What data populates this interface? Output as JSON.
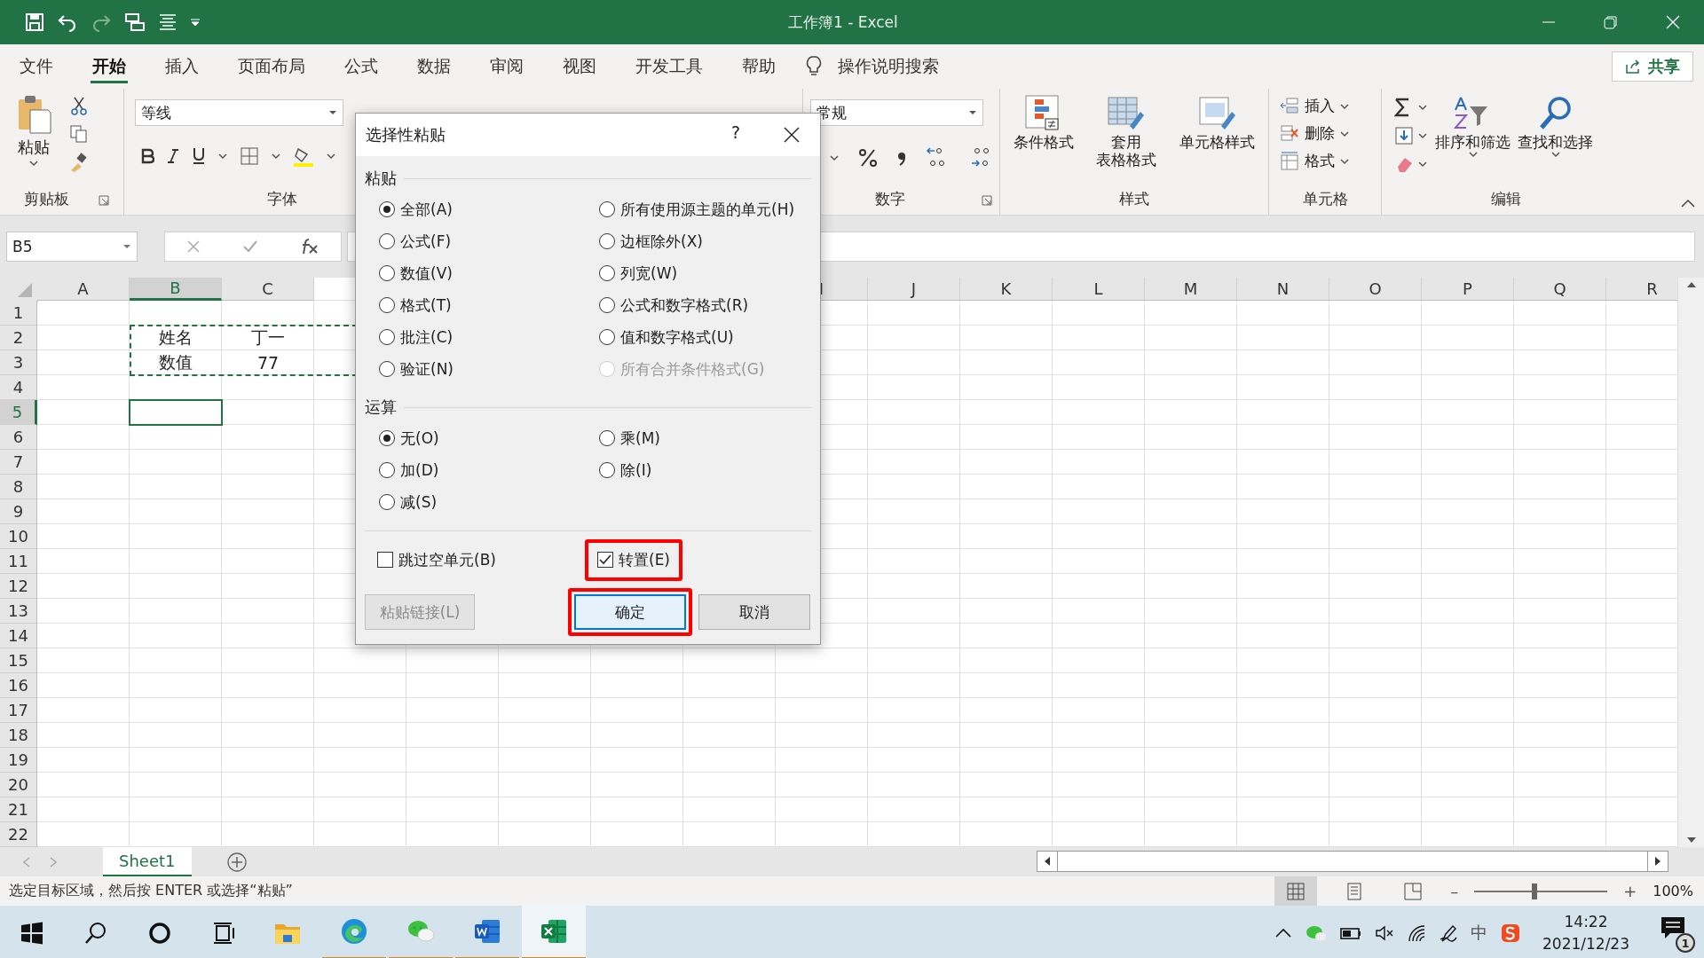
{
  "title_bar": {
    "title": "工作簿1  -  Excel"
  },
  "ribbon_tabs": [
    {
      "label": "文件",
      "selected": false
    },
    {
      "label": "开始",
      "selected": true
    },
    {
      "label": "插入",
      "selected": false
    },
    {
      "label": "页面布局",
      "selected": false
    },
    {
      "label": "公式",
      "selected": false
    },
    {
      "label": "数据",
      "selected": false
    },
    {
      "label": "审阅",
      "selected": false
    },
    {
      "label": "视图",
      "selected": false
    },
    {
      "label": "开发工具",
      "selected": false
    },
    {
      "label": "帮助",
      "selected": false
    }
  ],
  "tell_me": {
    "placeholder": "操作说明搜索"
  },
  "share_button": {
    "label": "共享"
  },
  "ribbon": {
    "clipboard": {
      "label": "剪贴板",
      "paste": "粘贴"
    },
    "font": {
      "label": "字体",
      "font_name": "等线"
    },
    "number": {
      "label": "数字",
      "format": "常规"
    },
    "styles": {
      "label": "样式",
      "buttons": [
        {
          "lines": [
            "条件格式"
          ]
        },
        {
          "lines": [
            "套用",
            "表格格式"
          ]
        },
        {
          "lines": [
            "单元格样式"
          ]
        }
      ]
    },
    "cells": {
      "label": "单元格",
      "buttons": [
        "插入",
        "删除",
        "格式"
      ]
    },
    "editing": {
      "label": "编辑",
      "buttons": [
        "排序和筛选",
        "查找和选择"
      ]
    }
  },
  "formula_bar": {
    "name_box": "B5"
  },
  "sheet": {
    "columns": [
      {
        "label": "A",
        "selected": false
      },
      {
        "label": "B",
        "selected": true
      },
      {
        "label": "C",
        "selected": false
      },
      {
        "label": "I",
        "selected": false
      },
      {
        "label": "J",
        "selected": false
      },
      {
        "label": "K",
        "selected": false
      },
      {
        "label": "L",
        "selected": false
      },
      {
        "label": "M",
        "selected": false
      },
      {
        "label": "N",
        "selected": false
      },
      {
        "label": "O",
        "selected": false
      },
      {
        "label": "P",
        "selected": false
      },
      {
        "label": "Q",
        "selected": false
      },
      {
        "label": "R",
        "selected": false
      }
    ],
    "rows": [
      {
        "header": "1",
        "selected": false
      },
      {
        "header": "2",
        "selected": false,
        "copied": true,
        "cells": {
          "B": "姓名",
          "C": "丁一"
        }
      },
      {
        "header": "3",
        "selected": false,
        "copied": true,
        "cells": {
          "B": "数值",
          "C": "77"
        }
      },
      {
        "header": "4",
        "selected": false
      },
      {
        "header": "5",
        "selected": true
      },
      {
        "header": "6",
        "selected": false
      },
      {
        "header": "7",
        "selected": false
      },
      {
        "header": "8",
        "selected": false
      },
      {
        "header": "9",
        "selected": false
      },
      {
        "header": "10",
        "selected": false
      },
      {
        "header": "11",
        "selected": false
      },
      {
        "header": "12",
        "selected": false
      },
      {
        "header": "13",
        "selected": false
      },
      {
        "header": "14",
        "selected": false
      },
      {
        "header": "15",
        "selected": false
      },
      {
        "header": "16",
        "selected": false
      },
      {
        "header": "17",
        "selected": false
      },
      {
        "header": "18",
        "selected": false
      },
      {
        "header": "19",
        "selected": false
      },
      {
        "header": "20",
        "selected": false
      },
      {
        "header": "21",
        "selected": false
      },
      {
        "header": "22",
        "selected": false
      }
    ]
  },
  "sheet_tabs": [
    {
      "label": "Sheet1",
      "selected": true
    }
  ],
  "status_bar": {
    "message": "选定目标区域，然后按 ENTER 或选择“粘贴”",
    "zoom_minus": "–",
    "zoom_plus": "+",
    "zoom": {
      "level": 0.45
    },
    "zoom_text": "100%"
  },
  "dialog": {
    "title": "选择性粘贴",
    "help": "?",
    "sections": [
      {
        "label": "粘贴",
        "options": [
          {
            "label": "全部(A)",
            "selected": true,
            "disabled": false
          },
          {
            "label": "所有使用源主题的单元(H)",
            "selected": false,
            "disabled": false
          },
          {
            "label": "公式(F)",
            "selected": false,
            "disabled": false
          },
          {
            "label": "边框除外(X)",
            "selected": false,
            "disabled": false
          },
          {
            "label": "数值(V)",
            "selected": false,
            "disabled": false
          },
          {
            "label": "列宽(W)",
            "selected": false,
            "disabled": false
          },
          {
            "label": "格式(T)",
            "selected": false,
            "disabled": false
          },
          {
            "label": "公式和数字格式(R)",
            "selected": false,
            "disabled": false
          },
          {
            "label": "批注(C)",
            "selected": false,
            "disabled": false
          },
          {
            "label": "值和数字格式(U)",
            "selected": false,
            "disabled": false
          },
          {
            "label": "验证(N)",
            "selected": false,
            "disabled": false
          },
          {
            "label": "所有合并条件格式(G)",
            "selected": false,
            "disabled": true
          }
        ]
      },
      {
        "label": "运算",
        "options": [
          {
            "label": "无(O)",
            "selected": true,
            "disabled": false
          },
          {
            "label": "乘(M)",
            "selected": false,
            "disabled": false
          },
          {
            "label": "加(D)",
            "selected": false,
            "disabled": false
          },
          {
            "label": "除(I)",
            "selected": false,
            "disabled": false
          },
          {
            "label": "减(S)",
            "selected": false,
            "disabled": false
          }
        ]
      }
    ],
    "checkboxes": [
      {
        "label": "跳过空单元(B)",
        "checked": false,
        "highlighted": false
      },
      {
        "label": "转置(E)",
        "checked": true,
        "highlighted": true
      }
    ],
    "buttons": [
      {
        "label": "粘贴链接(L)",
        "kind": "secondary",
        "disabled": true,
        "highlighted": false
      },
      {
        "label": "确定",
        "kind": "default",
        "disabled": false,
        "highlighted": true
      },
      {
        "label": "取消",
        "kind": "secondary",
        "disabled": false,
        "highlighted": false
      }
    ]
  },
  "taskbar": {
    "apps": [
      {
        "kind": "folder",
        "running": false,
        "selected": false
      },
      {
        "kind": "edge",
        "running": true,
        "selected": false
      },
      {
        "kind": "chat",
        "running": true,
        "selected": false
      },
      {
        "kind": "word",
        "running": true,
        "selected": false
      },
      {
        "kind": "excel",
        "running": true,
        "selected": true
      }
    ],
    "ime": "中",
    "time": "14:22",
    "date": "2021/12/23",
    "notifications": "1"
  }
}
